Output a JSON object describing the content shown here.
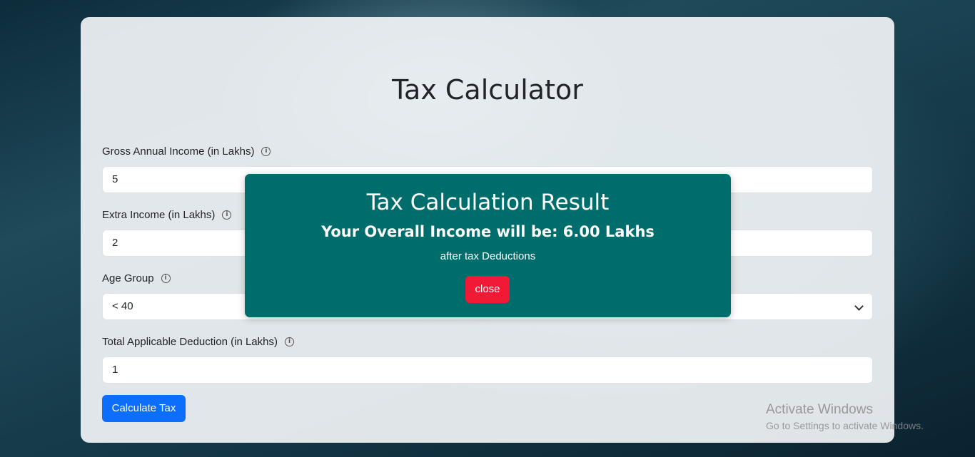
{
  "form": {
    "title": "Tax Calculator",
    "fields": [
      {
        "label": "Gross Annual Income (in Lakhs)",
        "value": "5"
      },
      {
        "label": "Extra Income (in Lakhs)",
        "value": "2"
      },
      {
        "label": "Age Group",
        "value": "< 40"
      },
      {
        "label": "Total Applicable Deduction (in Lakhs)",
        "value": "1"
      }
    ],
    "info_icon": "info-circle-icon",
    "submit_label": "Calculate Tax"
  },
  "modal": {
    "title": "Tax Calculation Result",
    "result": "Your Overall Income will be: 6.00 Lakhs",
    "note": "after tax Deductions",
    "close_label": "close"
  },
  "watermark": {
    "line1": "Activate Windows",
    "line2": "Go to Settings to activate Windows."
  },
  "colors": {
    "primary_button": "#0d6efd",
    "modal_background": "#006d6d",
    "close_button": "#f01936"
  }
}
